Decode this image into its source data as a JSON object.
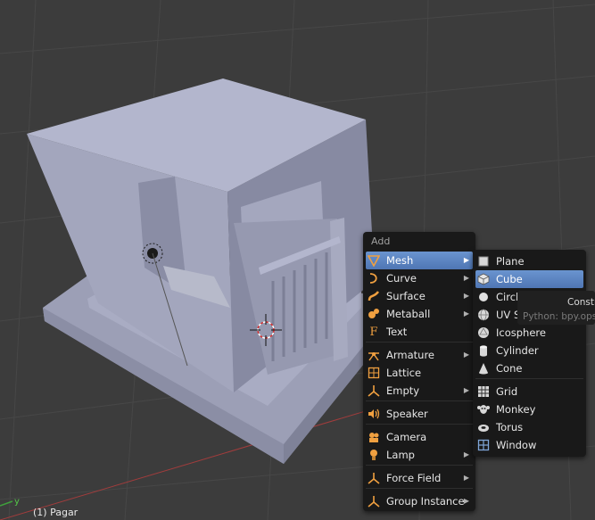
{
  "viewport": {
    "object_label": "(1) Pagar",
    "axis_label": "y",
    "colors": {
      "background": "#3c3c3c",
      "grid": "#464646",
      "model": "#a5a8be",
      "menu": "#191919",
      "highlight": "#5680c2",
      "x_axis": "#b04040",
      "y_axis": "#3fa03c"
    }
  },
  "add_menu": {
    "title": "Add",
    "items": [
      {
        "label": "Mesh",
        "icon": "mesh-icon",
        "submenu": true,
        "highlighted": true
      },
      {
        "label": "Curve",
        "icon": "curve-icon",
        "submenu": true
      },
      {
        "label": "Surface",
        "icon": "surface-icon",
        "submenu": true
      },
      {
        "label": "Metaball",
        "icon": "metaball-icon",
        "submenu": true
      },
      {
        "label": "Text",
        "icon": "text-icon",
        "submenu": false
      },
      {
        "label": "Armature",
        "icon": "armature-icon",
        "submenu": true
      },
      {
        "label": "Lattice",
        "icon": "lattice-icon",
        "submenu": false
      },
      {
        "label": "Empty",
        "icon": "empty-icon",
        "submenu": true
      },
      {
        "label": "Speaker",
        "icon": "speaker-icon",
        "submenu": false
      },
      {
        "label": "Camera",
        "icon": "camera-icon",
        "submenu": false
      },
      {
        "label": "Lamp",
        "icon": "lamp-icon",
        "submenu": true
      },
      {
        "label": "Force Field",
        "icon": "force-field-icon",
        "submenu": true
      },
      {
        "label": "Group Instance",
        "icon": "group-instance-icon",
        "submenu": true
      }
    ]
  },
  "mesh_menu": {
    "items": [
      {
        "label": "Plane",
        "icon": "plane-icon"
      },
      {
        "label": "Cube",
        "icon": "cube-icon",
        "highlighted": true
      },
      {
        "label": "Circle",
        "icon": "circle-icon"
      },
      {
        "label": "UV Sphere",
        "icon": "uv-sphere-icon"
      },
      {
        "label": "Icosphere",
        "icon": "icosphere-icon"
      },
      {
        "label": "Cylinder",
        "icon": "cylinder-icon"
      },
      {
        "label": "Cone",
        "icon": "cone-icon"
      },
      {
        "label": "Grid",
        "icon": "grid-icon"
      },
      {
        "label": "Monkey",
        "icon": "monkey-icon"
      },
      {
        "label": "Torus",
        "icon": "torus-icon"
      },
      {
        "label": "Window",
        "icon": "window-icon"
      }
    ]
  },
  "tooltip": {
    "title": "Constr",
    "python": "Python: bpy.ops."
  }
}
